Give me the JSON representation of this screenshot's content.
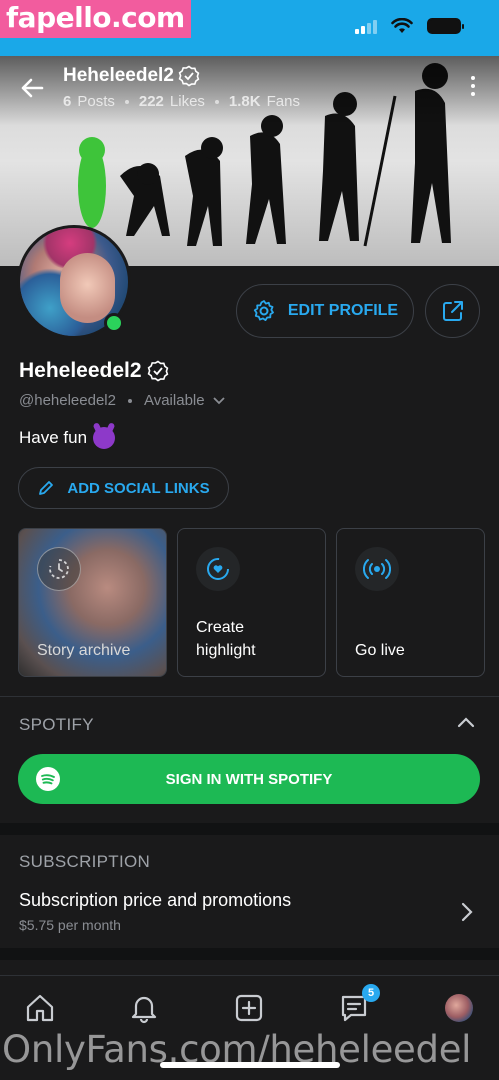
{
  "watermark_top": "fapello.com",
  "watermark_bottom": "OnlyFans.com/heheleedel",
  "header": {
    "name": "Heheleedel2",
    "stats": {
      "posts_value": "6",
      "posts_label": "Posts",
      "likes_value": "222",
      "likes_label": "Likes",
      "fans_value": "1.8K",
      "fans_label": "Fans"
    }
  },
  "profile": {
    "name": "Heheleedel2",
    "handle": "@heheleedel2",
    "status": "Available",
    "bio": "Have fun",
    "online": true,
    "edit_label": "EDIT PROFILE",
    "social_label": "ADD SOCIAL LINKS"
  },
  "highlights": [
    {
      "label": "Story archive"
    },
    {
      "label_line1": "Create",
      "label_line2": "highlight"
    },
    {
      "label": "Go live"
    }
  ],
  "spotify": {
    "title": "SPOTIFY",
    "button_label": "SIGN IN WITH SPOTIFY"
  },
  "subscription": {
    "title": "SUBSCRIPTION",
    "row_title": "Subscription price and promotions",
    "row_price": "$5.75 per month"
  },
  "nav": {
    "messages_badge": "5"
  },
  "colors": {
    "accent": "#29a9ef",
    "background": "#1a1a1b",
    "spotify": "#1db954",
    "online": "#2bd25b",
    "statusbar": "#1aa8e8"
  },
  "icons": [
    "back-arrow-icon",
    "verified-icon",
    "more-vertical-icon",
    "gear-icon",
    "share-icon",
    "chevron-down-icon",
    "pencil-icon",
    "history-icon",
    "heart-circle-icon",
    "broadcast-icon",
    "chevron-up-icon",
    "spotify-logo-icon",
    "chevron-right-icon",
    "home-icon",
    "bell-icon",
    "add-square-icon",
    "messages-icon"
  ]
}
